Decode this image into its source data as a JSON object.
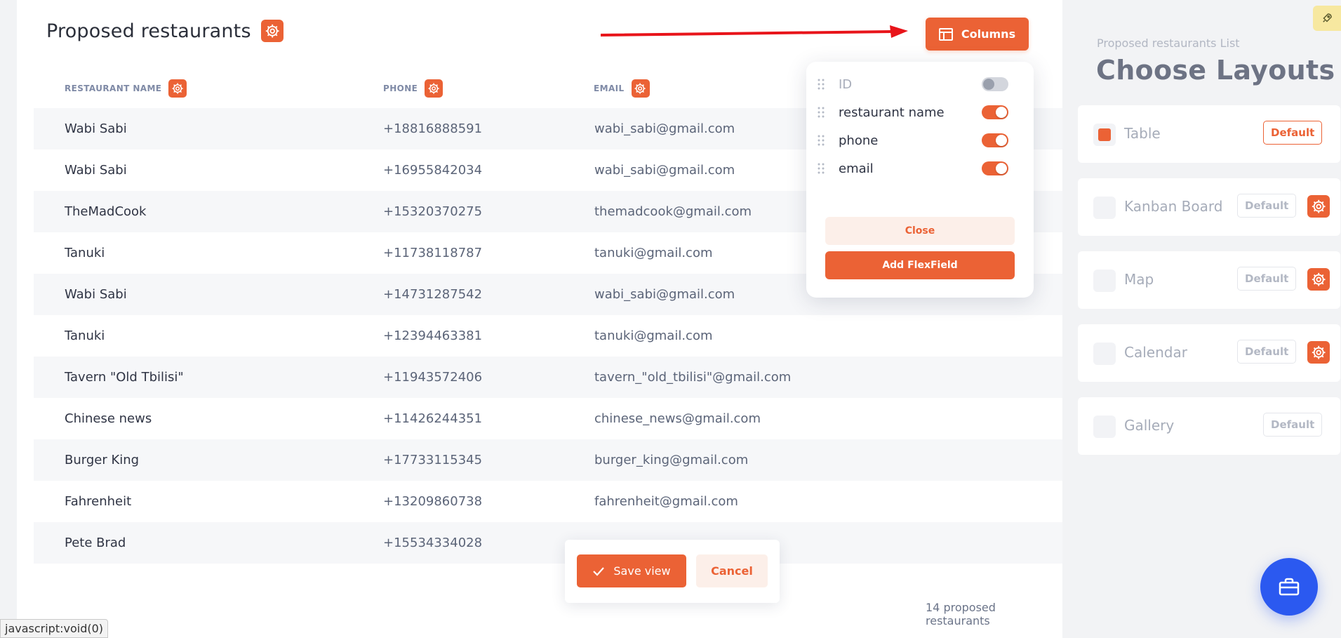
{
  "page": {
    "title": "Proposed restaurants",
    "count_label": "14 proposed restaurants",
    "status_url": "javascript:void(0)"
  },
  "toolbar": {
    "columns_label": "Columns"
  },
  "table": {
    "headers": [
      "RESTAURANT NAME",
      "PHONE",
      "EMAIL"
    ],
    "rows": [
      [
        "Wabi Sabi",
        "+18816888591",
        "wabi_sabi@gmail.com"
      ],
      [
        "Wabi Sabi",
        "+16955842034",
        "wabi_sabi@gmail.com"
      ],
      [
        "TheMadCook",
        "+15320370275",
        "themadcook@gmail.com"
      ],
      [
        "Tanuki",
        "+11738118787",
        "tanuki@gmail.com"
      ],
      [
        "Wabi Sabi",
        "+14731287542",
        "wabi_sabi@gmail.com"
      ],
      [
        "Tanuki",
        "+12394463381",
        "tanuki@gmail.com"
      ],
      [
        "Tavern \"Old Tbilisi\"",
        "+11943572406",
        "tavern_\"old_tbilisi\"@gmail.com"
      ],
      [
        "Chinese news",
        "+11426244351",
        "chinese_news@gmail.com"
      ],
      [
        "Burger King",
        "+17733115345",
        "burger_king@gmail.com"
      ],
      [
        "Fahrenheit",
        "+13209860738",
        "fahrenheit@gmail.com"
      ],
      [
        "Pete Brad",
        "+15534334028",
        ""
      ]
    ]
  },
  "columns_popup": {
    "items": [
      {
        "label": "ID",
        "enabled": false
      },
      {
        "label": "restaurant name",
        "enabled": true
      },
      {
        "label": "phone",
        "enabled": true
      },
      {
        "label": "email",
        "enabled": true
      }
    ],
    "close_label": "Close",
    "add_label": "Add FlexField"
  },
  "save_bar": {
    "save_label": "Save view",
    "cancel_label": "Cancel"
  },
  "sidebar": {
    "subtitle": "Proposed restaurants List",
    "title": "Choose Layouts",
    "layouts": [
      {
        "name": "Table",
        "default_label": "Default",
        "selected": true,
        "has_gear": false
      },
      {
        "name": "Kanban Board",
        "default_label": "Default",
        "selected": false,
        "has_gear": true
      },
      {
        "name": "Map",
        "default_label": "Default",
        "selected": false,
        "has_gear": true
      },
      {
        "name": "Calendar",
        "default_label": "Default",
        "selected": false,
        "has_gear": true
      },
      {
        "name": "Gallery",
        "default_label": "Default",
        "selected": false,
        "has_gear": false
      }
    ]
  },
  "colors": {
    "accent": "#eb6235",
    "fab": "#2b59f0",
    "arrow": "#e8141a"
  },
  "icons": {
    "title_gear": "gear-icon",
    "columns": "table-columns-icon",
    "save": "check-icon",
    "rocket": "rocket-icon",
    "fab": "briefcase-icon",
    "drag": "drag-handle-icon"
  }
}
